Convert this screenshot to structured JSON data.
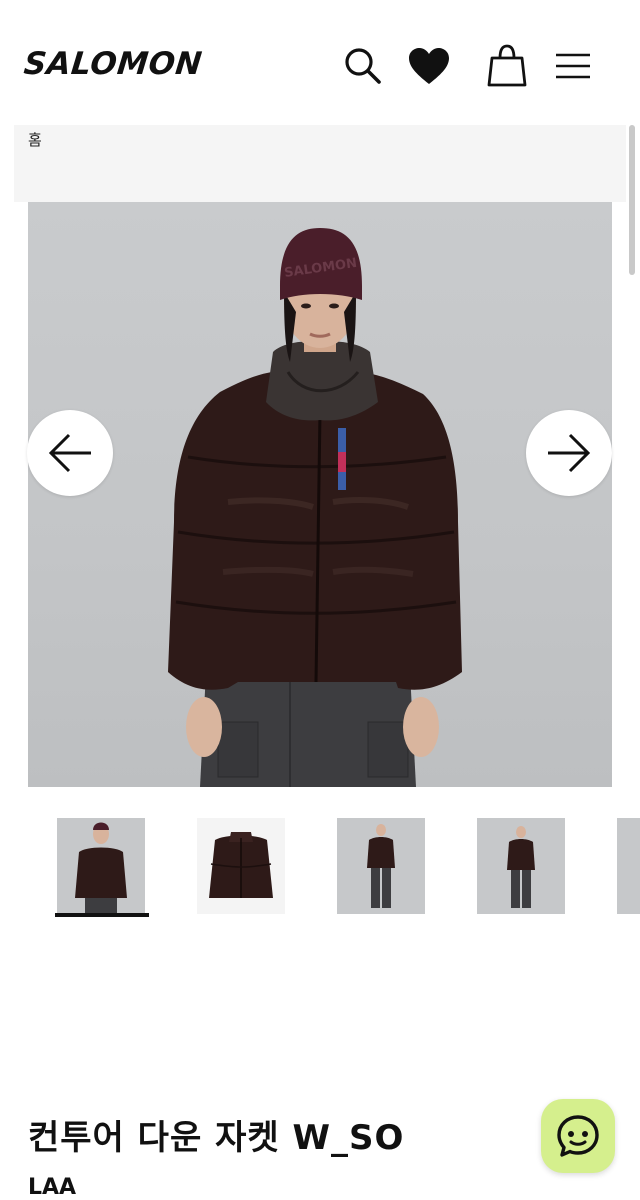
{
  "header": {
    "logo": "SALOMON",
    "icons": [
      "search-icon",
      "heart-icon",
      "shopping-bag-icon",
      "menu-icon"
    ]
  },
  "breadcrumb": {
    "home_label": "홈"
  },
  "gallery": {
    "prev_icon": "arrow-left-icon",
    "next_icon": "arrow-right-icon",
    "active_thumbnail": 1,
    "thumbnail_count": 5,
    "beanie_text": "SALOMON"
  },
  "product": {
    "title": "컨투어 다운 자켓 W_SO",
    "subtitle": "LAA"
  },
  "chat": {
    "icon": "chat-icon"
  },
  "colors": {
    "accent_chat": "#d5ef8d",
    "jacket": "#2e1a18",
    "beanie": "#4a1e2a"
  }
}
